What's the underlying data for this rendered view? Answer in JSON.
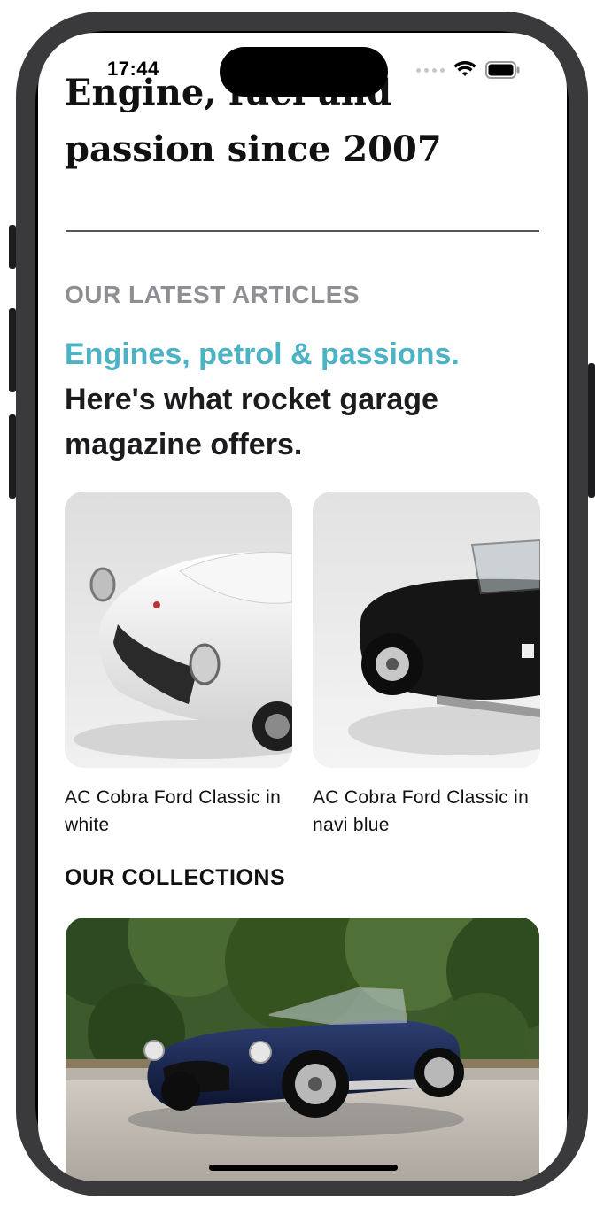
{
  "status": {
    "time": "17:44"
  },
  "hero": {
    "title": "Engine, fuel and passion since 2007"
  },
  "articles": {
    "eyebrow": "OUR LATEST ARTICLES",
    "headline_accent": "Engines, petrol & passions.",
    "headline_rest": "Here's what rocket garage magazine offers.",
    "items": [
      {
        "caption": "AC Cobra Ford Classic in white"
      },
      {
        "caption": "AC Cobra Ford Classic in navi blue"
      }
    ]
  },
  "collections": {
    "title": "OUR COLLECTIONS"
  },
  "colors": {
    "accent": "#4bb3c4",
    "text": "#1c1c1e",
    "muted": "#8e8e93"
  }
}
